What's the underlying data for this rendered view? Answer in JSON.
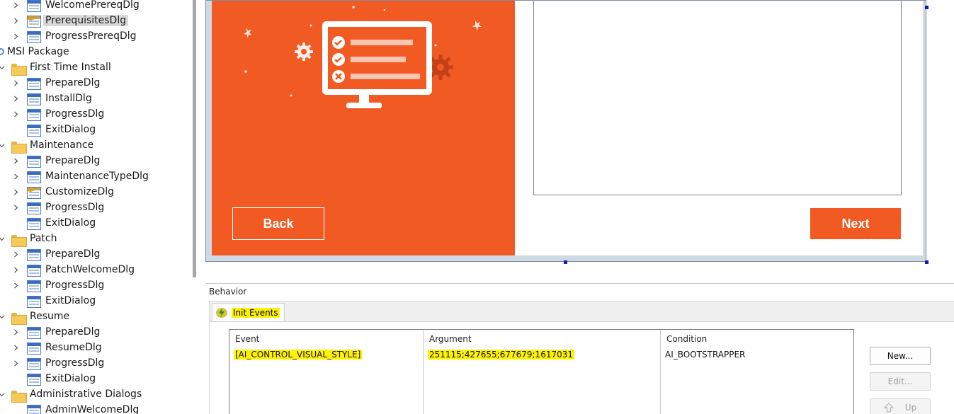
{
  "tree": {
    "items": [
      {
        "label": "WelcomePrereqDlg",
        "type": "dialog",
        "chevron": true,
        "indent": 2
      },
      {
        "label": "PrerequisitesDlg",
        "type": "dialog-special",
        "chevron": true,
        "indent": 2,
        "selected": true
      },
      {
        "label": "ProgressPrereqDlg",
        "type": "dialog",
        "chevron": true,
        "indent": 2
      },
      {
        "label": "MSI Package",
        "type": "package",
        "chevron": false,
        "indent": 0
      },
      {
        "label": "First Time Install",
        "type": "folder",
        "chevron": true,
        "indent": 1
      },
      {
        "label": "PrepareDlg",
        "type": "dialog",
        "chevron": true,
        "indent": 2
      },
      {
        "label": "InstallDlg",
        "type": "dialog",
        "chevron": true,
        "indent": 2
      },
      {
        "label": "ProgressDlg",
        "type": "dialog",
        "chevron": true,
        "indent": 2
      },
      {
        "label": "ExitDialog",
        "type": "dialog",
        "chevron": false,
        "indent": 2
      },
      {
        "label": "Maintenance",
        "type": "folder",
        "chevron": true,
        "indent": 1
      },
      {
        "label": "PrepareDlg",
        "type": "dialog",
        "chevron": true,
        "indent": 2
      },
      {
        "label": "MaintenanceTypeDlg",
        "type": "dialog",
        "chevron": true,
        "indent": 2
      },
      {
        "label": "CustomizeDlg",
        "type": "dialog-special",
        "chevron": true,
        "indent": 2
      },
      {
        "label": "ProgressDlg",
        "type": "dialog",
        "chevron": true,
        "indent": 2
      },
      {
        "label": "ExitDialog",
        "type": "dialog",
        "chevron": false,
        "indent": 2
      },
      {
        "label": "Patch",
        "type": "folder",
        "chevron": true,
        "indent": 1
      },
      {
        "label": "PrepareDlg",
        "type": "dialog",
        "chevron": true,
        "indent": 2
      },
      {
        "label": "PatchWelcomeDlg",
        "type": "dialog",
        "chevron": true,
        "indent": 2
      },
      {
        "label": "ProgressDlg",
        "type": "dialog",
        "chevron": true,
        "indent": 2
      },
      {
        "label": "ExitDialog",
        "type": "dialog",
        "chevron": false,
        "indent": 2
      },
      {
        "label": "Resume",
        "type": "folder",
        "chevron": true,
        "indent": 1
      },
      {
        "label": "PrepareDlg",
        "type": "dialog",
        "chevron": true,
        "indent": 2
      },
      {
        "label": "ResumeDlg",
        "type": "dialog",
        "chevron": true,
        "indent": 2
      },
      {
        "label": "ProgressDlg",
        "type": "dialog",
        "chevron": true,
        "indent": 2
      },
      {
        "label": "ExitDialog",
        "type": "dialog",
        "chevron": false,
        "indent": 2
      },
      {
        "label": "Administrative Dialogs",
        "type": "folder",
        "chevron": true,
        "indent": 1
      },
      {
        "label": "AdminWelcomeDlg",
        "type": "dialog",
        "chevron": false,
        "indent": 2
      }
    ]
  },
  "dialog": {
    "back_label": "Back",
    "next_label": "Next",
    "accent_color": "#f15a22"
  },
  "behavior": {
    "title": "Behavior",
    "tab_label": "Init Events",
    "columns": [
      "Event",
      "Argument",
      "Condition"
    ],
    "rows": [
      {
        "event": "[AI_CONTROL_VISUAL_STYLE]",
        "argument": "251115;427655;677679;1617031",
        "condition": "AI_BOOTSTRAPPER"
      }
    ],
    "buttons": {
      "new": "New...",
      "edit": "Edit...",
      "up": "Up"
    }
  }
}
